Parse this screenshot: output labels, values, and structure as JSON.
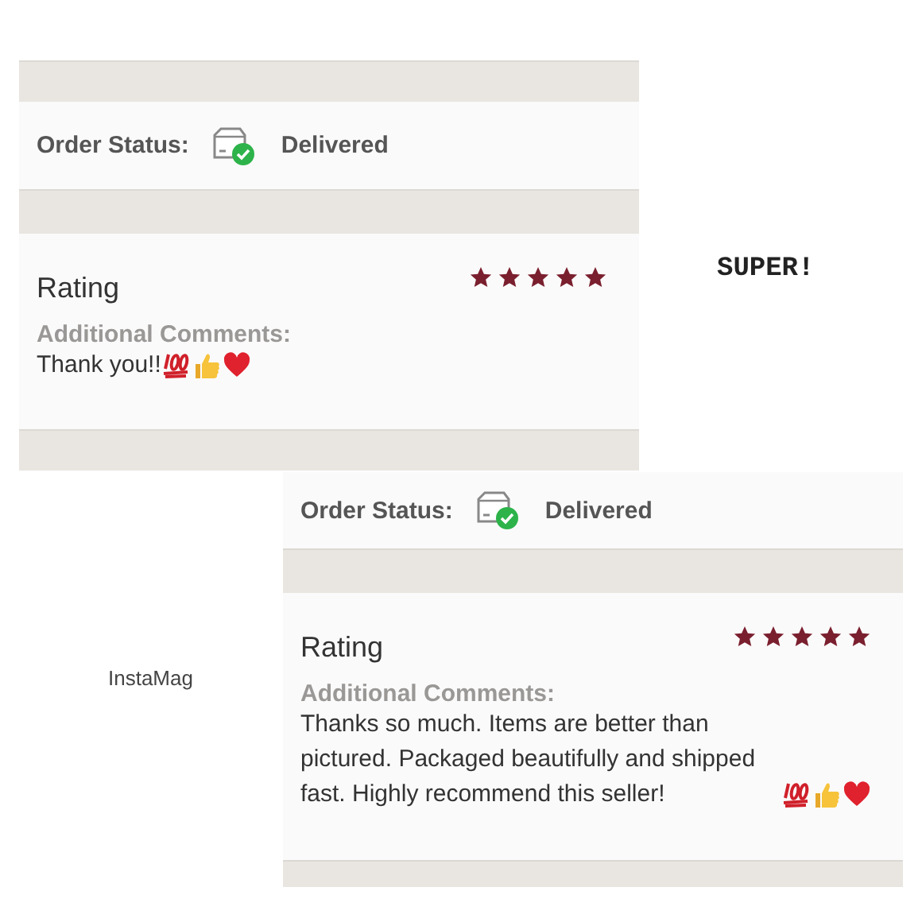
{
  "cards": [
    {
      "order_status_label": "Order Status:",
      "status": "Delivered",
      "rating_label": "Rating",
      "stars": 5,
      "comments_label": "Additional Comments:",
      "comment": "Thank you!!"
    },
    {
      "order_status_label": "Order Status:",
      "status": "Delivered",
      "rating_label": "Rating",
      "stars": 5,
      "comments_label": "Additional Comments:",
      "comment": "Thanks so much. Items are better than pictured. Packaged beautifully and shipped fast. Highly recommend this seller!"
    }
  ],
  "caption": "SUPER!",
  "app_label": "InstaMag"
}
